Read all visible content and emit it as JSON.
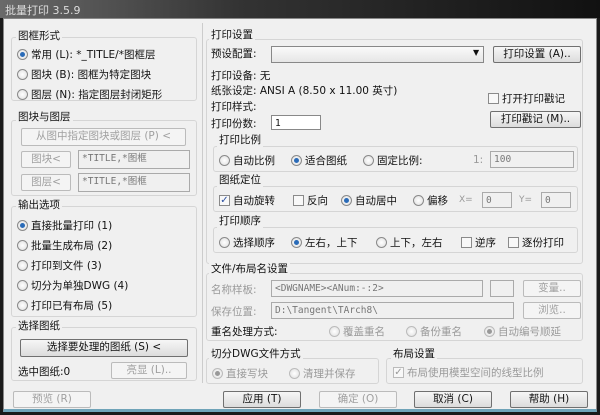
{
  "title": "批量打印 3.5.9",
  "frame": {
    "label": "图框形式",
    "options": [
      "常用 (L): *_TITLE/*图框层",
      "图块 (B): 图框为特定图块",
      "图层 (N): 指定图层封闭矩形"
    ],
    "selected": 0
  },
  "blocklayer": {
    "label": "图块与图层",
    "pick_button": "从图中指定图块或图层 (P) <",
    "block_button": "图块<",
    "block_value": "*TITLE,*图框",
    "layer_button": "图层<",
    "layer_value": "*TITLE,*图框"
  },
  "output": {
    "label": "输出选项",
    "options": [
      "直接批量打印 (1)",
      "批量生成布局 (2)",
      "打印到文件 (3)",
      "切分为单独DWG (4)",
      "打印已有布局 (5)"
    ],
    "selected": 0
  },
  "select": {
    "label": "选择图纸",
    "select_button": "选择要处理的图纸 (S) <",
    "count_label": "选中图纸:0",
    "highlight_button": "亮显 (L).."
  },
  "preview_button": "预览 (R)",
  "print": {
    "label": "打印设置",
    "preset_label": "预设配置:",
    "preset_value": "",
    "settings_button": "打印设置 (A)..",
    "device": "打印设备: 无",
    "paper": "纸张设定: ANSI A (8.50 x 11.00 英寸)",
    "style": "打印样式:",
    "copies_label": "打印份数:",
    "copies_value": "1",
    "stamp_checkbox": "打开打印戳记",
    "stamp_button": "打印戳记 (M).."
  },
  "scale": {
    "label": "打印比例",
    "options": [
      "自动比例",
      "适合图纸",
      "固定比例:"
    ],
    "selected": 1,
    "ratio_prefix": "1:",
    "ratio_value": "100"
  },
  "position": {
    "label": "图纸定位",
    "auto_rotate": "自动旋转",
    "reverse": "反向",
    "auto_center": "自动居中",
    "offset": "偏移",
    "x_label": "X=",
    "x_value": "0",
    "y_label": "Y=",
    "y_value": "0"
  },
  "order": {
    "label": "打印顺序",
    "options": [
      "选择顺序",
      "左右，上下",
      "上下，左右"
    ],
    "selected": 1,
    "reverse": "逆序",
    "collate": "逐份打印"
  },
  "file": {
    "label": "文件/布局名设置",
    "template_label": "名称样板:",
    "template_value": "<DWGNAME><ANum:-:2>",
    "variable_button": "变量..",
    "location_label": "保存位置:",
    "location_value": "D:\\Tangent\\TArch8\\",
    "browse_button": "浏览..",
    "dup_label": "重名处理方式:",
    "dup_options": [
      "覆盖重名",
      "备份重名",
      "自动编号顺延"
    ],
    "dup_selected": 2
  },
  "split": {
    "label": "切分DWG文件方式",
    "options": [
      "直接写块",
      "清理并保存"
    ],
    "selected": 0
  },
  "layout": {
    "label": "布局设置",
    "checkbox": "布局使用模型空间的线型比例"
  },
  "buttons": {
    "apply": "应用 (T)",
    "ok": "确定 (O)",
    "cancel": "取消 (C)",
    "help": "帮助 (H)"
  }
}
